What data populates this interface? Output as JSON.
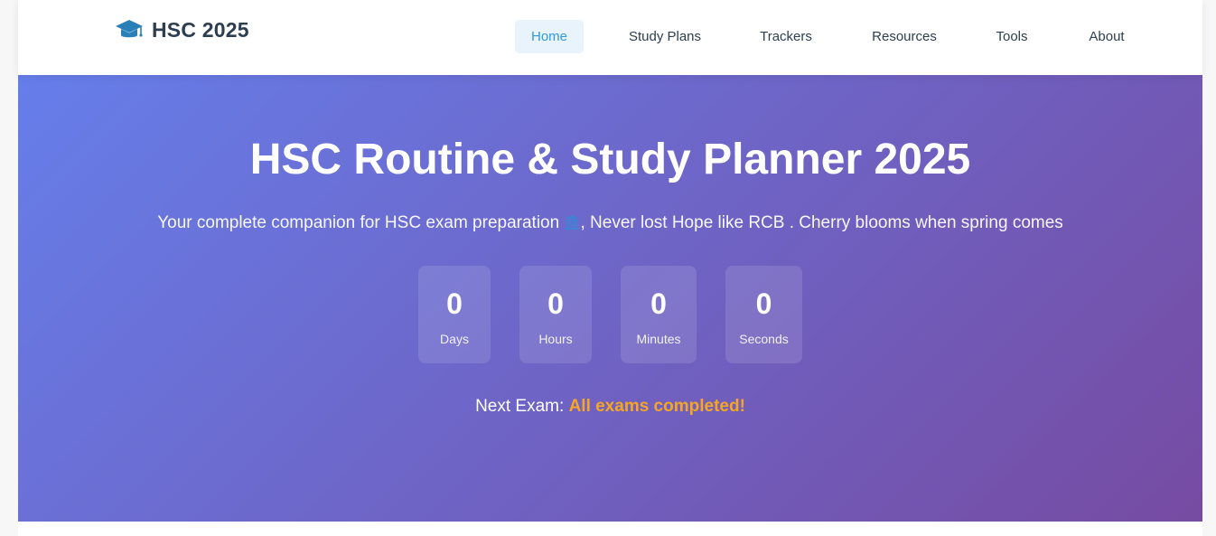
{
  "brand": {
    "icon": "graduation-cap-icon",
    "title": "HSC 2025",
    "color": "#2c3e50",
    "icon_color": "#2980b9"
  },
  "nav": {
    "items": [
      {
        "label": "Home",
        "active": true
      },
      {
        "label": "Study Plans",
        "active": false
      },
      {
        "label": "Trackers",
        "active": false
      },
      {
        "label": "Resources",
        "active": false
      },
      {
        "label": "Tools",
        "active": false
      },
      {
        "label": "About",
        "active": false
      }
    ],
    "active_color": "#3498db"
  },
  "hero": {
    "title": "HSC Routine & Study Planner 2025",
    "subtitle_before_icon": "Your complete companion for HSC exam preparation",
    "subtitle_icon": "building-columns-icon",
    "subtitle_after_icon": ", Never lost Hope like RCB . Cherry blooms when spring comes",
    "gradient_start": "#667eea",
    "gradient_end": "#764ba2"
  },
  "countdown": {
    "days": {
      "value": "0",
      "label": "Days"
    },
    "hours": {
      "value": "0",
      "label": "Hours"
    },
    "minutes": {
      "value": "0",
      "label": "Minutes"
    },
    "seconds": {
      "value": "0",
      "label": "Seconds"
    }
  },
  "next_exam": {
    "label": "Next Exam:",
    "value": "All exams completed!",
    "highlight_color": "#f5a623"
  }
}
